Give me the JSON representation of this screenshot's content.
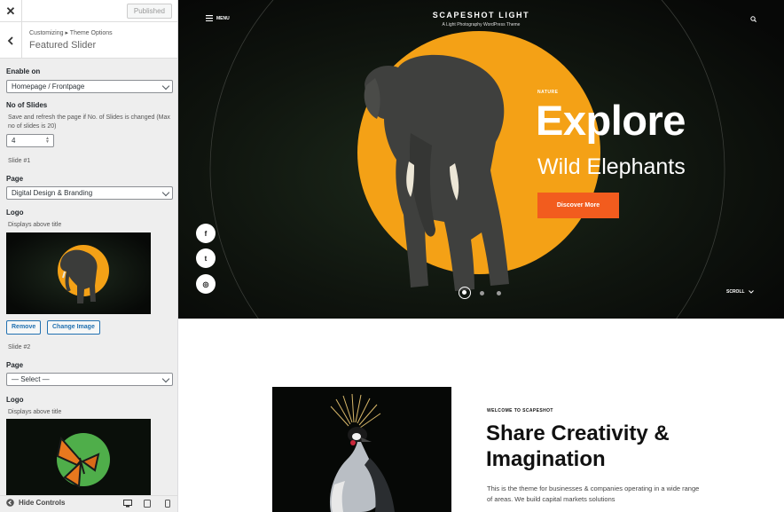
{
  "customizer": {
    "publish_label": "Published",
    "breadcrumb": "Customizing ▸ Theme Options",
    "section_title": "Featured Slider",
    "enable_on": {
      "label": "Enable on",
      "value": "Homepage / Frontpage"
    },
    "num_slides": {
      "label": "No of Slides",
      "note": "Save and refresh the page if No. of Slides is changed (Max no of slides is 20)",
      "value": "4"
    },
    "slides": [
      {
        "heading": "Slide #1",
        "page_label": "Page",
        "page_value": "Digital Design & Branding",
        "logo_label": "Logo",
        "logo_note": "Displays above title",
        "remove_label": "Remove",
        "change_label": "Change Image"
      },
      {
        "heading": "Slide #2",
        "page_label": "Page",
        "page_value": "— Select —",
        "logo_label": "Logo",
        "logo_note": "Displays above title"
      }
    ],
    "hide_controls_label": "Hide Controls"
  },
  "site": {
    "title": "SCAPESHOT LIGHT",
    "tagline": "A Light Photography WordPress Theme",
    "menu_label": "MENU"
  },
  "hero": {
    "eyebrow": "NATURE",
    "title": "Explore",
    "subtitle": "Wild Elephants",
    "cta": "Discover More",
    "scroll_label": "SCROLL",
    "active_slide_index": 0,
    "slide_dot_count": 3
  },
  "social": [
    "f",
    "t",
    "◎"
  ],
  "about": {
    "eyebrow": "WELCOME TO SCAPESHOT",
    "headline": "Share Creativity & Imagination",
    "body": "This is the theme for businesses & companies operating in a wide range of areas. We build capital markets solutions"
  },
  "colors": {
    "accent_orange": "#f25c1e",
    "sun_yellow": "#f4a116",
    "wp_blue": "#2271b1"
  }
}
